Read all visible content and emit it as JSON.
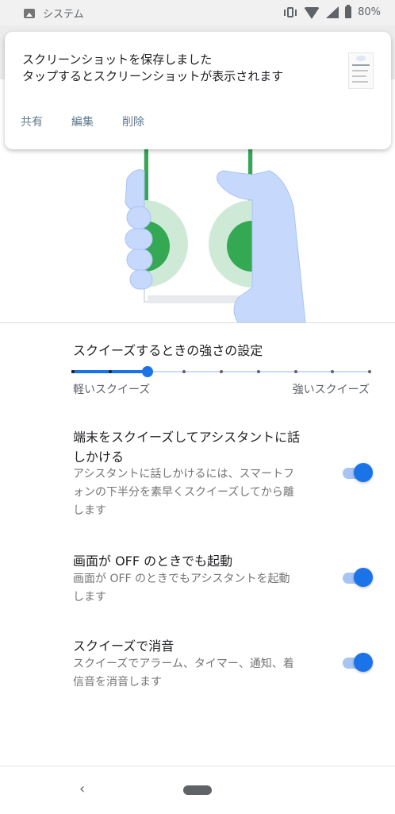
{
  "status_bar": {
    "app_label": "システム",
    "battery": "80%"
  },
  "notification": {
    "title_line1": "スクリーンショットを保存しました",
    "title_line2": "タップするとスクリーンショットが表示されます",
    "actions": [
      "共有",
      "編集",
      "削除"
    ]
  },
  "slider": {
    "title": "スクイーズするときの強さの設定",
    "min_label": "軽いスクイーズ",
    "max_label": "強いスクイーズ",
    "steps": 9,
    "selected_index": 2
  },
  "settings": [
    {
      "title_line1": "端末をスクイーズしてアシスタントに話",
      "title_line2": "しかける",
      "summary_line1": "アシスタントに話しかけるには、スマートフ",
      "summary_line2": "ォンの下半分を素早くスクイーズしてから離",
      "summary_line3": "します",
      "enabled": true
    },
    {
      "title": "画面が OFF のときでも起動",
      "summary_line1": "画面が OFF のときでもアシスタントを起動",
      "summary_line2": "します",
      "enabled": true
    },
    {
      "title": "スクイーズで消音",
      "summary_line1": "スクイーズでアラーム、タイマー、通知、着",
      "summary_line2": "信音を消音します",
      "enabled": true
    }
  ],
  "colors": {
    "accent": "#1a73e8",
    "switch_track": "#a7c4f4",
    "illustration_hand": "#c6d8fb",
    "illustration_green": "#34a853",
    "illustration_green_light": "#ceead6"
  },
  "icons": [
    "image-icon",
    "vibrate-icon",
    "wifi-icon",
    "cell-signal-icon",
    "battery-icon",
    "back-icon",
    "home-pill-icon"
  ]
}
